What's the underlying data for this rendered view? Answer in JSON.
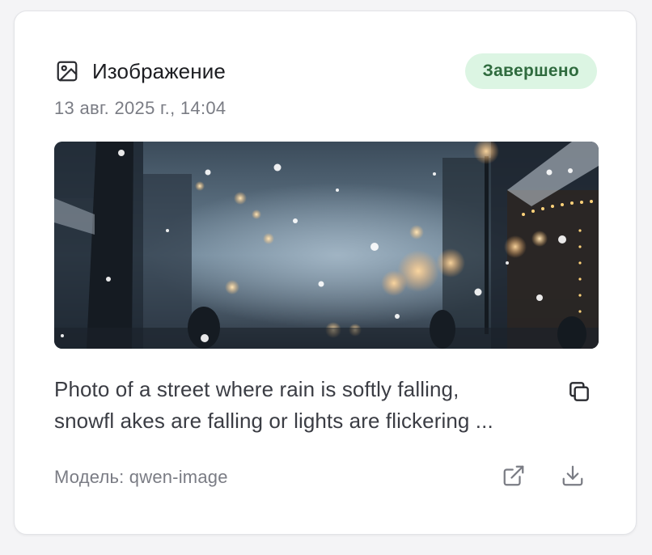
{
  "card": {
    "type_icon": "image-icon",
    "type_label": "Изображение",
    "status": "Завершено",
    "timestamp": "13 авг. 2025 г., 14:04",
    "prompt_line1": "Photo of a street where rain is softly falling,",
    "prompt_line2": "snowfl akes are falling or lights are flickering ...",
    "model_label": "Модель: qwen-image"
  },
  "icons": {
    "copy": "copy-icon",
    "open": "external-link-icon",
    "download": "download-icon"
  },
  "colors": {
    "status_bg": "#dcf5e3",
    "status_text": "#2f6b3e",
    "muted_text": "#7a7c84",
    "primary_text": "#1c1d21"
  }
}
